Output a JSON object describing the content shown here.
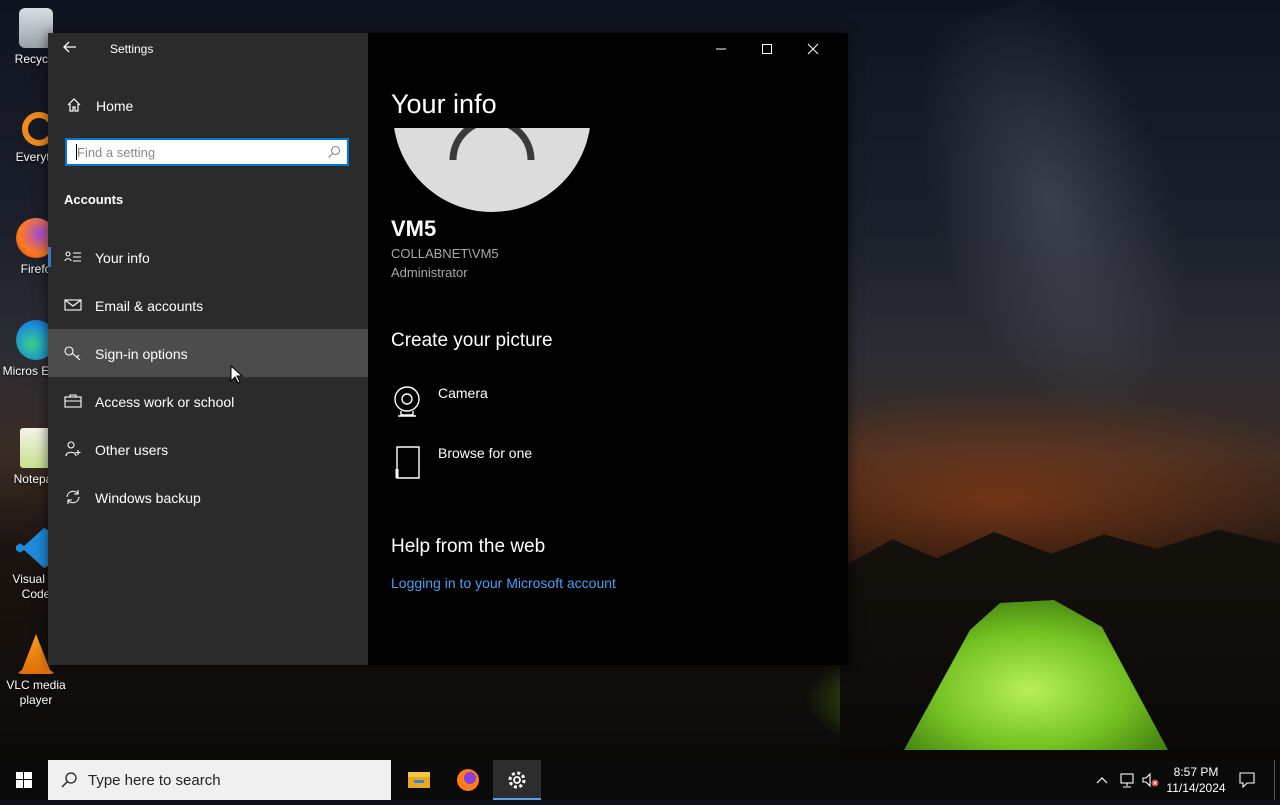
{
  "desktop": {
    "icons": [
      {
        "label": "Recycle"
      },
      {
        "label": "Everyth"
      },
      {
        "label": "Firefo"
      },
      {
        "label": "Micros Edge"
      },
      {
        "label": "Notepac"
      },
      {
        "label": "Visual St Code"
      },
      {
        "label": "VLC media player"
      }
    ]
  },
  "window": {
    "title": "Settings",
    "home_label": "Home",
    "search_placeholder": "Find a setting",
    "section": "Accounts",
    "nav": [
      {
        "label": "Your info",
        "icon": "contact-card-icon"
      },
      {
        "label": "Email & accounts",
        "icon": "mail-icon"
      },
      {
        "label": "Sign-in options",
        "icon": "key-icon"
      },
      {
        "label": "Access work or school",
        "icon": "briefcase-icon"
      },
      {
        "label": "Other users",
        "icon": "person-add-icon"
      },
      {
        "label": "Windows backup",
        "icon": "sync-icon"
      }
    ]
  },
  "main": {
    "title": "Your info",
    "user": {
      "name": "VM5",
      "account": "COLLABNET\\VM5",
      "role": "Administrator"
    },
    "create_picture": {
      "heading": "Create your picture",
      "options": [
        {
          "label": "Camera",
          "icon": "webcam-icon"
        },
        {
          "label": "Browse for one",
          "icon": "document-icon"
        }
      ]
    },
    "help": {
      "heading": "Help from the web",
      "link": "Logging in to your Microsoft account"
    }
  },
  "taskbar": {
    "search_placeholder": "Type here to search",
    "time": "8:57 PM",
    "date": "11/14/2024"
  },
  "colors": {
    "accent": "#0078d7",
    "link": "#4a9ef5",
    "sidebar_bg": "#2b2b2b",
    "hover_bg": "#4c4c4c"
  }
}
